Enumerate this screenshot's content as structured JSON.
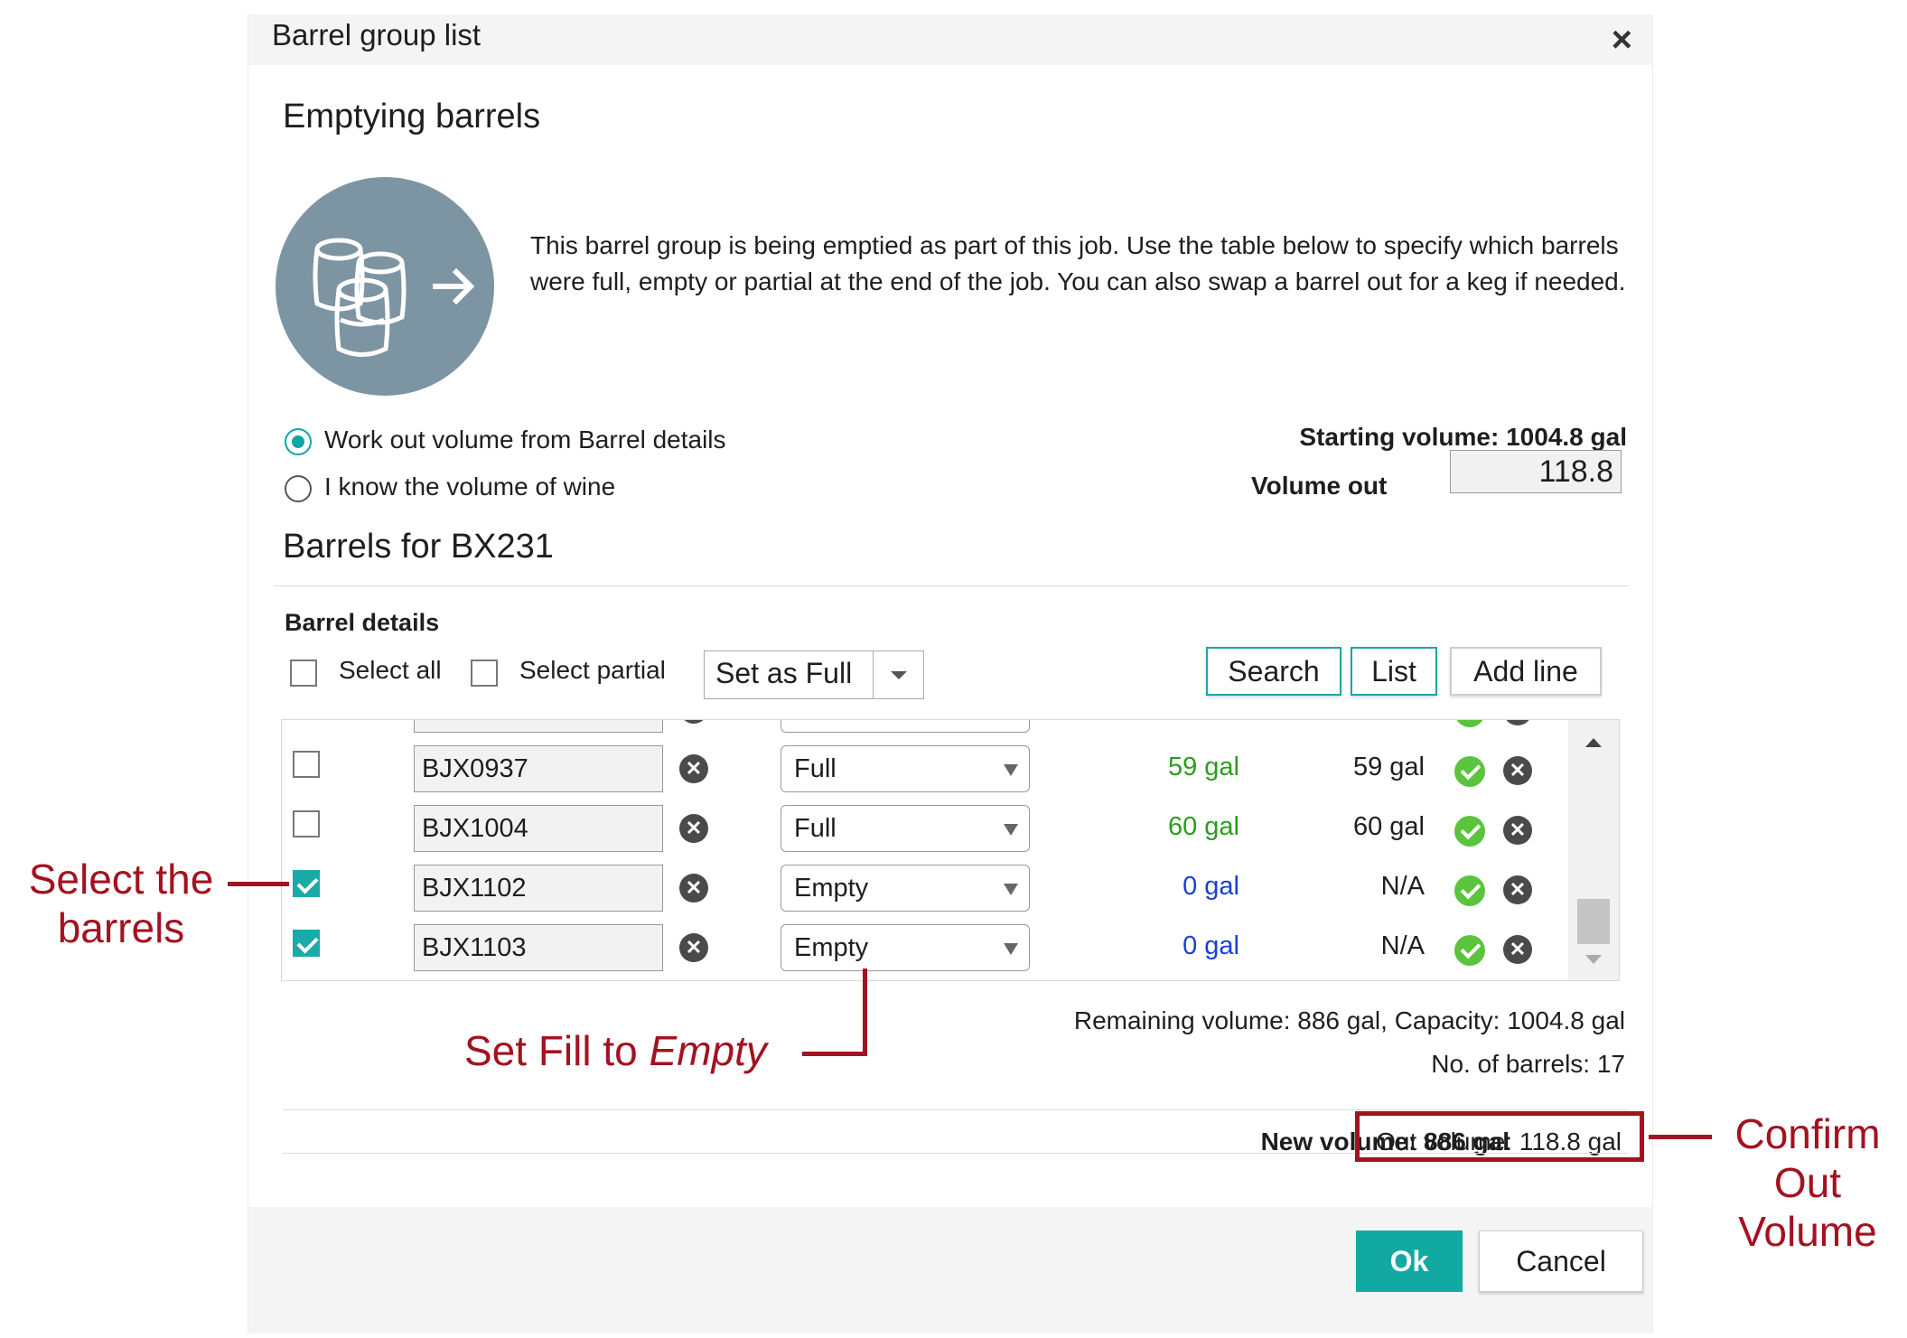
{
  "dialog": {
    "title": "Barrel group list",
    "close_icon": "close-icon"
  },
  "section": {
    "heading": "Emptying barrels",
    "description": "This barrel group is being emptied as part of this job. Use the table below to specify which barrels were full, empty or partial at the end of the job. You can also swap a barrel out for a keg if needed."
  },
  "options": {
    "work_out": "Work out volume from Barrel details",
    "know_volume": "I know the volume of wine",
    "selected": "work_out"
  },
  "volumes": {
    "starting": "Starting volume: 1004.8 gal",
    "volume_out_label": "Volume out",
    "volume_out_value": "118.8"
  },
  "barrels": {
    "heading": "Barrels for BX231",
    "details_label": "Barrel details",
    "select_all": "Select all",
    "select_partial": "Select partial",
    "set_as": "Set as Full",
    "search_button": "Search",
    "list_button": "List",
    "add_line_button": "Add line",
    "rows": [
      {
        "checked": false,
        "id": "BJX0937",
        "fill": "Full",
        "volume": "59 gal",
        "volume_color": "green",
        "current": "59 gal"
      },
      {
        "checked": false,
        "id": "BJX1004",
        "fill": "Full",
        "volume": "60 gal",
        "volume_color": "green",
        "current": "60 gal"
      },
      {
        "checked": true,
        "id": "BJX1102",
        "fill": "Empty",
        "volume": "0 gal",
        "volume_color": "blue",
        "current": "N/A"
      },
      {
        "checked": true,
        "id": "BJX1103",
        "fill": "Empty",
        "volume": "0 gal",
        "volume_color": "blue",
        "current": "N/A"
      }
    ],
    "remaining": "Remaining volume: 886 gal, Capacity: 1004.8 gal",
    "count": "No. of barrels: 17"
  },
  "summary": {
    "new_volume": "New volume: 886 gal",
    "out_volume": "Out volume: 118.8 gal"
  },
  "footer": {
    "ok": "Ok",
    "cancel": "Cancel"
  },
  "annotations": {
    "select_line1": "Select the",
    "select_line2": "barrels",
    "set_fill": "Set Fill to ",
    "set_fill_em": "Empty",
    "confirm_line1": "Confirm",
    "confirm_line2": "Out",
    "confirm_line3": "Volume"
  },
  "colors": {
    "accent": "#1aa5a5",
    "annotation": "#a31220",
    "full_volume": "#2a9d1e",
    "empty_volume": "#1a3fd6"
  }
}
